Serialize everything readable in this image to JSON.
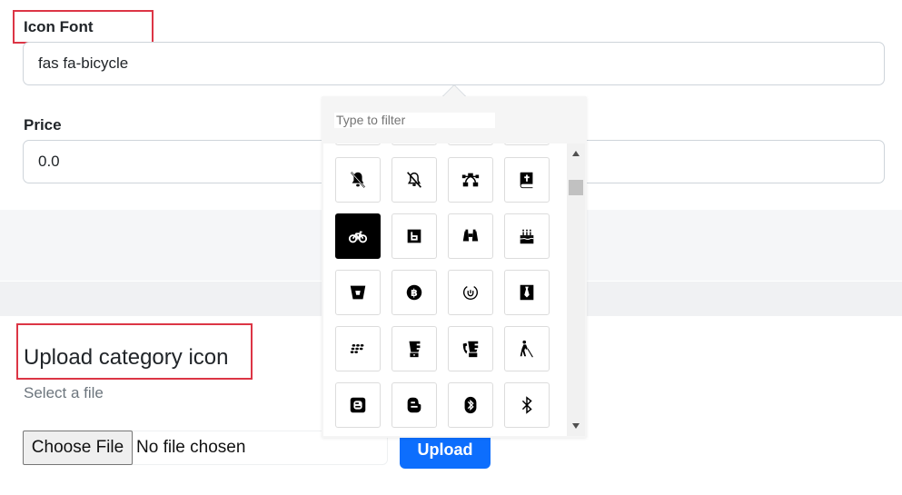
{
  "icon_font": {
    "label": "Icon Font",
    "value": "fas fa-bicycle"
  },
  "price": {
    "label": "Price",
    "value": "0.0"
  },
  "upload": {
    "title": "Upload category icon",
    "subtitle": "Select a file",
    "choose_label": "Choose File",
    "no_file_text": "No file chosen",
    "button_label": "Upload"
  },
  "icon_picker": {
    "filter_placeholder": "Type to filter",
    "selected_icon": "bicycle-icon",
    "icons": [
      "bell-slash-icon",
      "bell-slash-outline-icon",
      "bezier-curve-icon",
      "bible-icon",
      "bicycle-icon",
      "bimobject-icon",
      "binoculars-icon",
      "birthday-cake-icon",
      "bitbucket-icon",
      "bitcoin-icon",
      "bity-icon",
      "black-tie-icon",
      "blackberry-icon",
      "blender-icon",
      "blender-phone-icon",
      "blind-icon",
      "blogger-icon",
      "blogger-b-icon",
      "bluetooth-icon",
      "bluetooth-b-icon"
    ]
  },
  "colors": {
    "highlight_box": "#dc3545",
    "primary_button": "#0d6efd",
    "band": "#f5f6f8"
  }
}
